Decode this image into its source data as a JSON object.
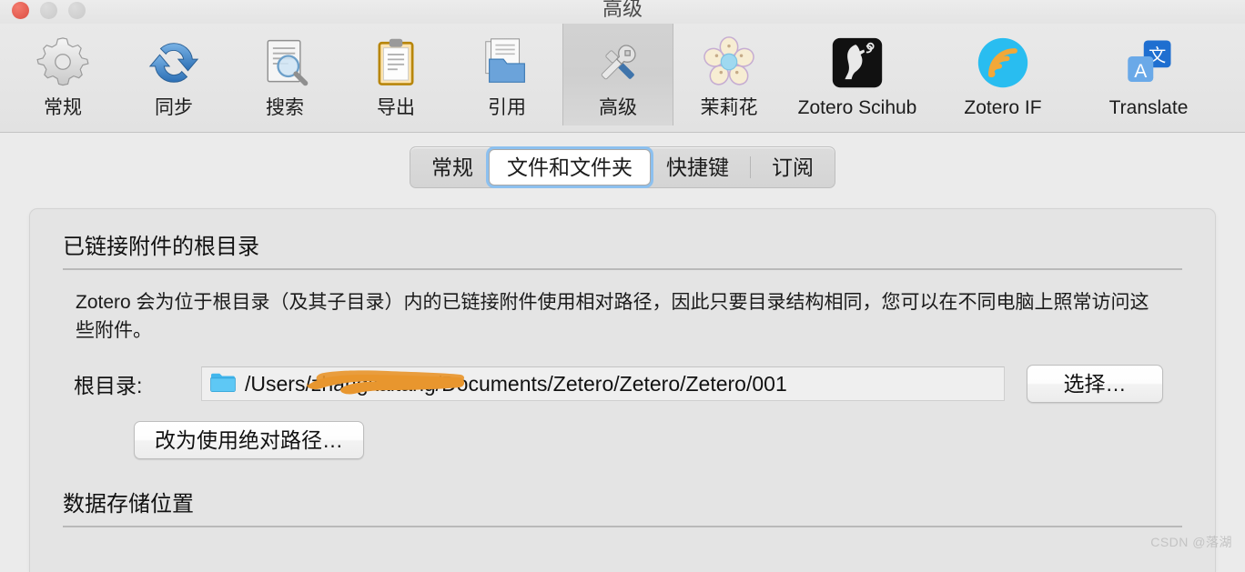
{
  "window": {
    "title": "高级",
    "traffic_lights": [
      "close",
      "minimize",
      "zoom"
    ]
  },
  "toolbar": {
    "items": [
      {
        "label": "常规",
        "icon": "gear-icon",
        "selected": false
      },
      {
        "label": "同步",
        "icon": "sync-icon",
        "selected": false
      },
      {
        "label": "搜索",
        "icon": "search-doc-icon",
        "selected": false
      },
      {
        "label": "导出",
        "icon": "clipboard-icon",
        "selected": false
      },
      {
        "label": "引用",
        "icon": "folder-docs-icon",
        "selected": false
      },
      {
        "label": "高级",
        "icon": "tools-icon",
        "selected": true
      },
      {
        "label": "茉莉花",
        "icon": "flower-icon",
        "selected": false
      },
      {
        "label": "Zotero Scihub",
        "icon": "raven-icon",
        "selected": false
      },
      {
        "label": "Zotero IF",
        "icon": "rss-icon",
        "selected": false
      },
      {
        "label": "Translate",
        "icon": "translate-icon",
        "selected": false
      }
    ]
  },
  "tabs": [
    {
      "label": "常规",
      "selected": false,
      "separator_after": false
    },
    {
      "label": "文件和文件夹",
      "selected": true,
      "separator_after": false
    },
    {
      "label": "快捷键",
      "selected": false,
      "separator_after": true
    },
    {
      "label": "订阅",
      "selected": false,
      "separator_after": false
    }
  ],
  "linked_attachments": {
    "heading": "已链接附件的根目录",
    "description": "Zotero 会为位于根目录（及其子目录）内的已链接附件使用相对路径，因此只要目录结构相同，您可以在不同电脑上照常访问这些附件。",
    "path_label": "根目录:",
    "path_value": "/Users/zhangkaitang/Documents/Zetero/Zetero/Zetero/001",
    "path_prefix": "/Users/z",
    "path_suffix": "g/Documents/Zetero/Zetero/Zetero/001",
    "folder_icon": "folder-icon",
    "choose_button": "选择…",
    "absolute_path_button": "改为使用绝对路径…",
    "redaction_color": "#e8962e"
  },
  "data_storage": {
    "heading": "数据存储位置"
  },
  "watermark": {
    "text": "CSDN @落湖"
  },
  "colors": {
    "window_bg": "#ebebeb",
    "panel_bg": "#e4e4e4",
    "toolbar_bg": "#e6e6e6",
    "tab_focus_ring": "#8cc0ef",
    "accent_redaction": "#e8962e"
  }
}
